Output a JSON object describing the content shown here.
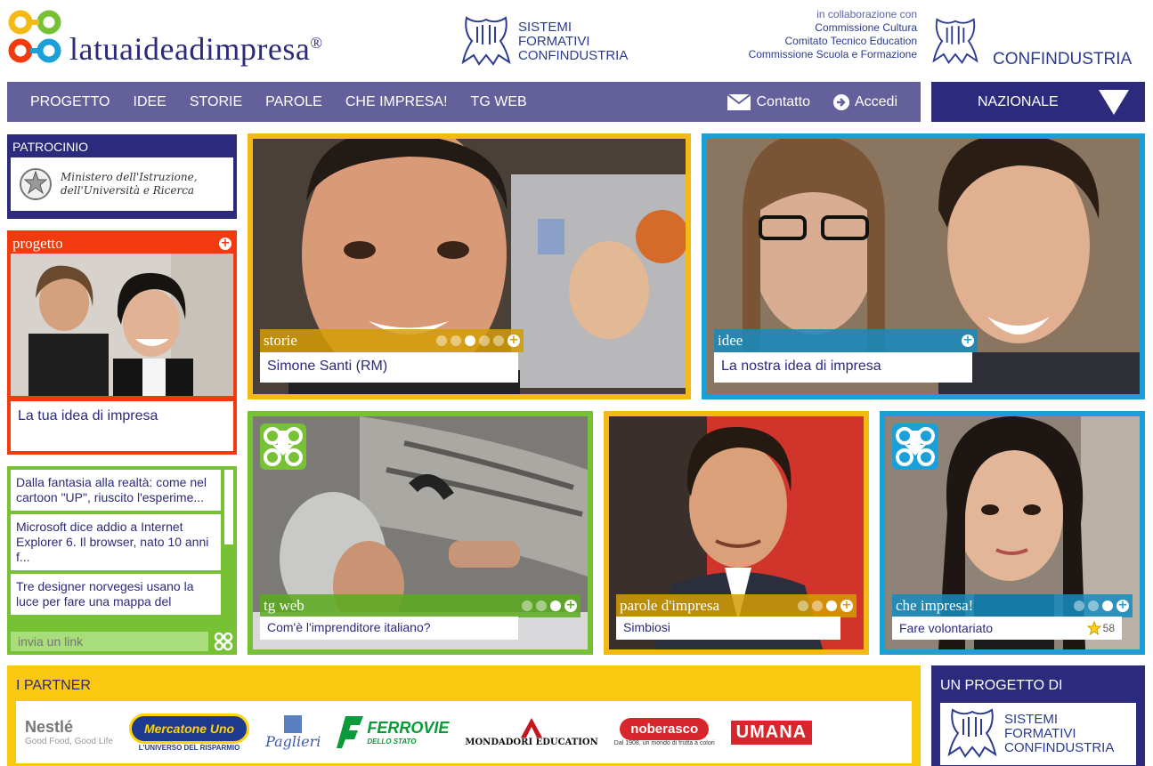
{
  "header": {
    "brand": "latuaideadimpresa",
    "brand_mark": "®",
    "sfc_lines": [
      "SISTEMI",
      "FORMATIVI",
      "CONFINDUSTRIA"
    ],
    "collab_lead": "in collaborazione con",
    "collab_lines": [
      "Commissione Cultura",
      "Comitato Tecnico Education",
      "Commissione Scuola e Formazione"
    ],
    "confindustria": "CONFINDUSTRIA"
  },
  "nav": {
    "items": [
      "PROGETTO",
      "IDEE",
      "STORIE",
      "PAROLE",
      "CHE IMPRESA!",
      "TG WEB"
    ],
    "contact": "Contatto",
    "login": "Accedi",
    "region": "NAZIONALE"
  },
  "patrocinio": {
    "title": "PATROCINIO",
    "line1": "Ministero dell'Istruzione,",
    "line2": "dell'Università e Ricerca"
  },
  "progetto": {
    "title": "progetto",
    "caption": "La tua idea di impresa"
  },
  "news": {
    "items": [
      "Dalla fantasia alla realtà: come nel cartoon \"UP\", riuscito l'esperime...",
      "Microsoft dice addio a Internet Explorer 6. Il browser, nato 10 anni f...",
      "Tre designer norvegesi usano la luce per fare una mappa del"
    ],
    "input_placeholder": "invia un link"
  },
  "tiles": {
    "storie": {
      "section": "storie",
      "caption": "Simone Santi (RM)",
      "dots_active": 3,
      "dots_total": 5
    },
    "idee": {
      "section": "idee",
      "caption": "La nostra idea di impresa"
    },
    "tgweb": {
      "section": "tg web",
      "caption": "Com'è l'imprenditore italiano?",
      "dots_active": 3,
      "dots_total": 3
    },
    "parole": {
      "section": "parole d'impresa",
      "caption": "Simbiosi",
      "dots_active": 3,
      "dots_total": 3
    },
    "che": {
      "section": "che impresa!",
      "caption": "Fare volontariato",
      "rating": "58",
      "dots_active": 3,
      "dots_total": 3
    }
  },
  "partners": {
    "title": "I PARTNER",
    "logos": [
      {
        "name": "Nestlé",
        "tag": "Good Food, Good Life"
      },
      {
        "name": "Mercatone Uno",
        "tag": "L'UNIVERSO DEL RISPARMIO"
      },
      {
        "name": "Paglieri",
        "tag": ""
      },
      {
        "name": "FERROVIE",
        "tag": "DELLO STATO"
      },
      {
        "name": "MONDADORI EDUCATION",
        "tag": ""
      },
      {
        "name": "noberasco",
        "tag": "Dal 1908, un mondo di frutta a colori"
      },
      {
        "name": "UMANA",
        "tag": ""
      }
    ]
  },
  "un_progetto": {
    "title": "UN PROGETTO DI",
    "lines": [
      "SISTEMI",
      "FORMATIVI",
      "CONFINDUSTRIA"
    ]
  },
  "colors": {
    "navy": "#2b2a7c",
    "nav_purple": "#64609b",
    "orange": "#f23a0f",
    "yellow": "#f4b914",
    "blue": "#1aa0d8",
    "green": "#76c234"
  }
}
